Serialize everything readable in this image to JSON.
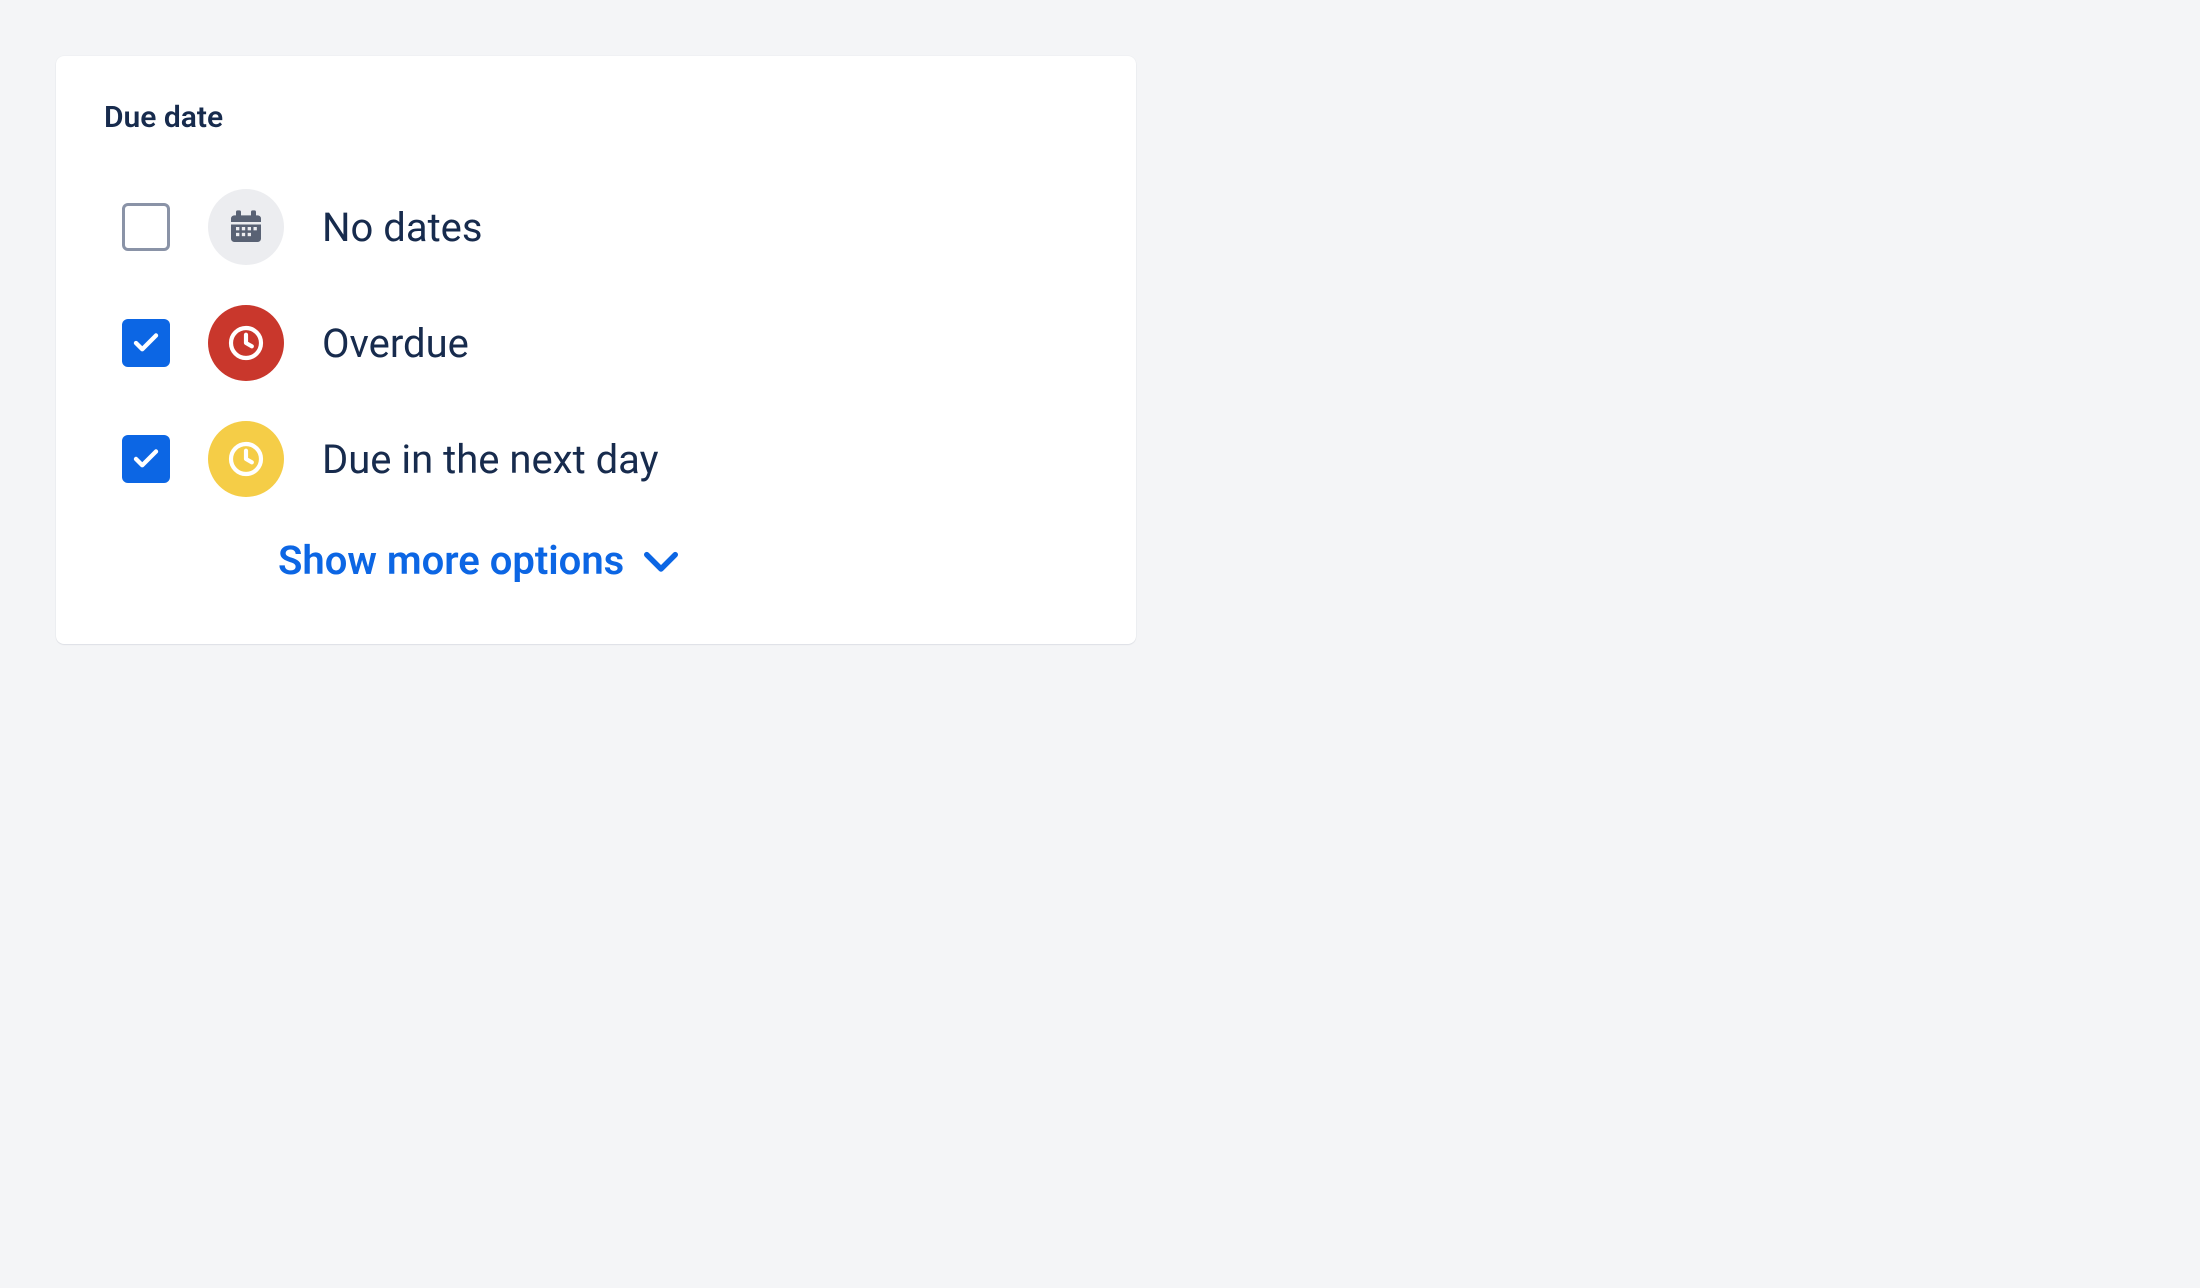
{
  "section": {
    "title": "Due date"
  },
  "options": [
    {
      "label": "No dates",
      "checked": false,
      "icon": "calendar",
      "badgeColor": "gray",
      "iconColor": "#596274"
    },
    {
      "label": "Overdue",
      "checked": true,
      "icon": "clock",
      "badgeColor": "red",
      "iconColor": "#ffffff"
    },
    {
      "label": "Due in the next day",
      "checked": true,
      "icon": "clock",
      "badgeColor": "yellow",
      "iconColor": "#ffffff"
    }
  ],
  "showMore": {
    "label": "Show more options"
  },
  "colors": {
    "primary": "#0C66E4",
    "text": "#172B4D",
    "red": "#C9372C",
    "yellow": "#F5CD47",
    "grayBadge": "#ecedf0"
  }
}
